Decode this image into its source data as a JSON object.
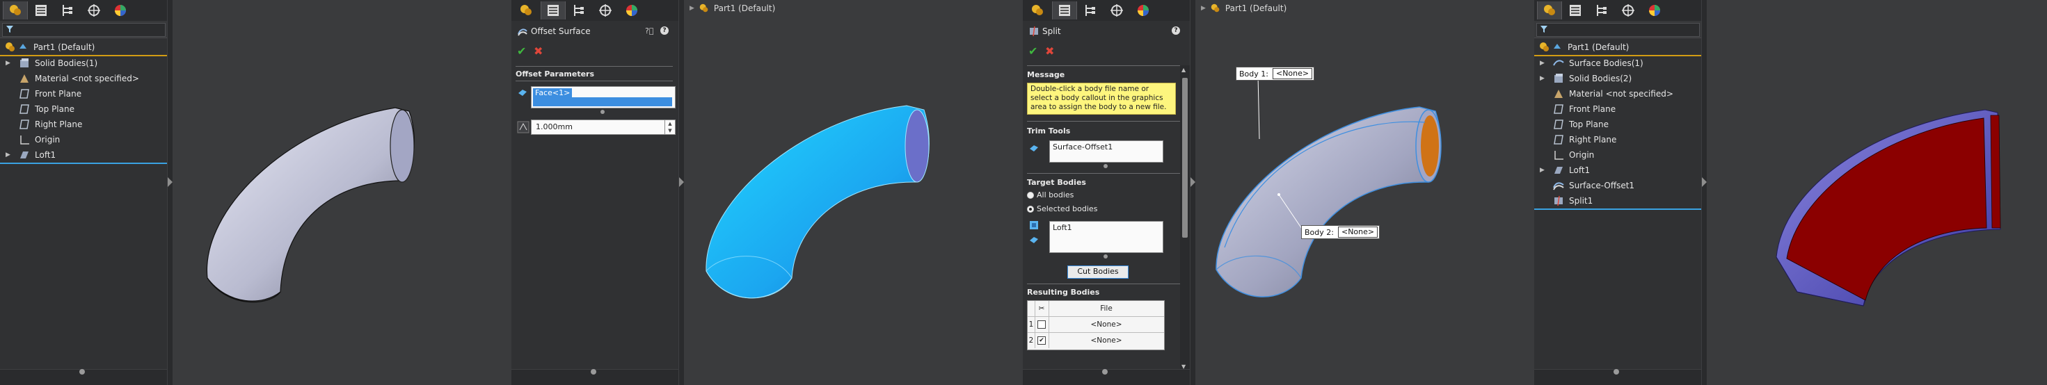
{
  "pane1": {
    "tree_root": "Part1  (Default)",
    "tree_items": [
      "Solid Bodies(1)",
      "Material <not specified>",
      "Front Plane",
      "Top Plane",
      "Right Plane",
      "Origin",
      "Loft1"
    ]
  },
  "pane2": {
    "pm_title": "Offset Surface",
    "section": "Offset Parameters",
    "face_value": "Face<1>",
    "distance_value": "1.000mm",
    "viewport_title": "Part1  (Default)"
  },
  "pane3": {
    "pm_title": "Split",
    "message_title": "Message",
    "message_text": "Double-click a body file name or select a body callout in the graphics area to assign the body to a new file.",
    "trim_title": "Trim Tools",
    "trim_value": "Surface-Offset1",
    "target_title": "Target Bodies",
    "radio_all": "All bodies",
    "radio_selected": "Selected bodies",
    "target_value": "Loft1",
    "cut_button": "Cut Bodies",
    "result_title": "Resulting Bodies",
    "grid_header_file": "File",
    "grid_rows": [
      {
        "num": "1",
        "file": "<None>"
      },
      {
        "num": "2",
        "file": "<None>"
      }
    ],
    "viewport_title": "Part1  (Default)",
    "callout1_label": "Body  1:",
    "callout1_value": "<None>",
    "callout2_label": "Body  2:",
    "callout2_value": "<None>"
  },
  "pane4": {
    "tree_root": "Part1  (Default)",
    "tree_items": [
      "Surface Bodies(1)",
      "Solid Bodies(2)",
      "Material <not specified>",
      "Front Plane",
      "Top Plane",
      "Right Plane",
      "Origin",
      "Loft1",
      "Surface-Offset1",
      "Split1"
    ]
  },
  "colors": {
    "panel_bg": "#303133",
    "viewport_bg": "#3a3b3d",
    "accent_orange": "#d29c14",
    "selection_blue": "#3aa2e2",
    "offset_cyan": "#1fb0f0",
    "split_red": "#8b0000"
  }
}
